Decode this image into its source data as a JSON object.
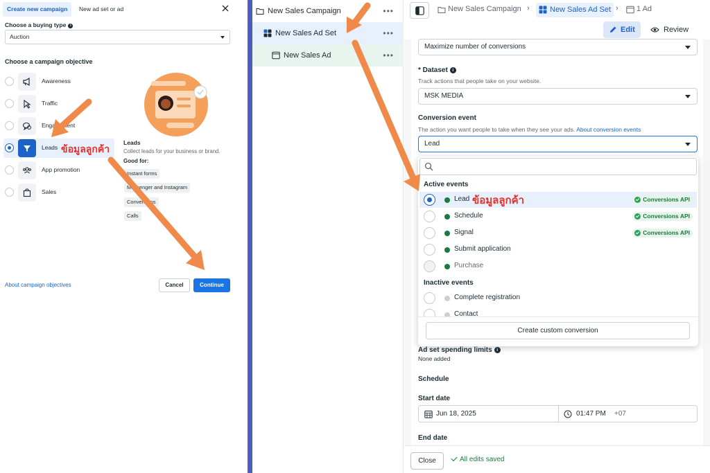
{
  "left": {
    "tabs": {
      "active": "Create new campaign",
      "other": "New ad set or ad"
    },
    "buying_type_label": "Choose a buying type",
    "buying_type_value": "Auction",
    "objective_heading": "Choose a campaign objective",
    "objectives": [
      {
        "label": "Awareness",
        "icon": "megaphone-icon"
      },
      {
        "label": "Traffic",
        "icon": "cursor-icon"
      },
      {
        "label": "Engagement",
        "icon": "chat-icon"
      },
      {
        "label": "Leads",
        "icon": "funnel-icon",
        "selected": true
      },
      {
        "label": "App promotion",
        "icon": "people-icon"
      },
      {
        "label": "Sales",
        "icon": "shopping-bag-icon"
      }
    ],
    "detail": {
      "title": "Leads",
      "description": "Collect leads for your business or brand.",
      "good_for_label": "Good for:",
      "good_for": [
        "Instant forms",
        "Messenger and Instagram",
        "Conversions",
        "Calls"
      ]
    },
    "about_link": "About campaign objectives",
    "cancel_label": "Cancel",
    "continue_label": "Continue"
  },
  "annotations": {
    "thai_leads": "ข้อมูลลูกค้า",
    "thai_lead_event": "ข้อมูลลูกค้า"
  },
  "tree": {
    "campaign": "New Sales Campaign",
    "adset": "New Sales Ad Set",
    "ad": "New Sales Ad",
    "more": "•••"
  },
  "right": {
    "breadcrumb": {
      "campaign": "New Sales Campaign",
      "adset": "New Sales Ad Set",
      "ad": "1 Ad"
    },
    "edit_label": "Edit",
    "review_label": "Review",
    "optimization_value": "Maximize number of conversions",
    "dataset_label": "Dataset",
    "dataset_help": "Track actions that people take on your website.",
    "dataset_value": "MSK MEDIA",
    "conversion_event_label": "Conversion event",
    "conversion_event_help": "The action you want people to take when they see your ads.",
    "conversion_event_link": "About conversion events",
    "conversion_event_value": "Lead",
    "dropdown": {
      "active_heading": "Active events",
      "inactive_heading": "Inactive events",
      "active": [
        {
          "label": "Lead",
          "badge": "Conversions API",
          "selected": true
        },
        {
          "label": "Schedule",
          "badge": "Conversions API"
        },
        {
          "label": "Signal",
          "badge": "Conversions API"
        },
        {
          "label": "Submit application",
          "badge": ""
        },
        {
          "label": "Purchase",
          "badge": "",
          "disabled": true
        }
      ],
      "inactive": [
        {
          "label": "Complete registration"
        },
        {
          "label": "Contact"
        }
      ],
      "create_label": "Create custom conversion"
    },
    "spending_limits_label": "Ad set spending limits",
    "spending_limits_value": "None added",
    "schedule_label": "Schedule",
    "start_date_label": "Start date",
    "start_date_value": "Jun 18, 2025",
    "start_time_value": "01:47 PM",
    "timezone_value": "+07",
    "end_date_label": "End date",
    "close_label": "Close",
    "saved_label": "All edits saved"
  },
  "colors": {
    "accent": "#1b74e4",
    "arrow": "#f08a4b",
    "annotation": "#e4312b",
    "divider": "#4a5fbd",
    "event_active": "#1b7a3f"
  }
}
